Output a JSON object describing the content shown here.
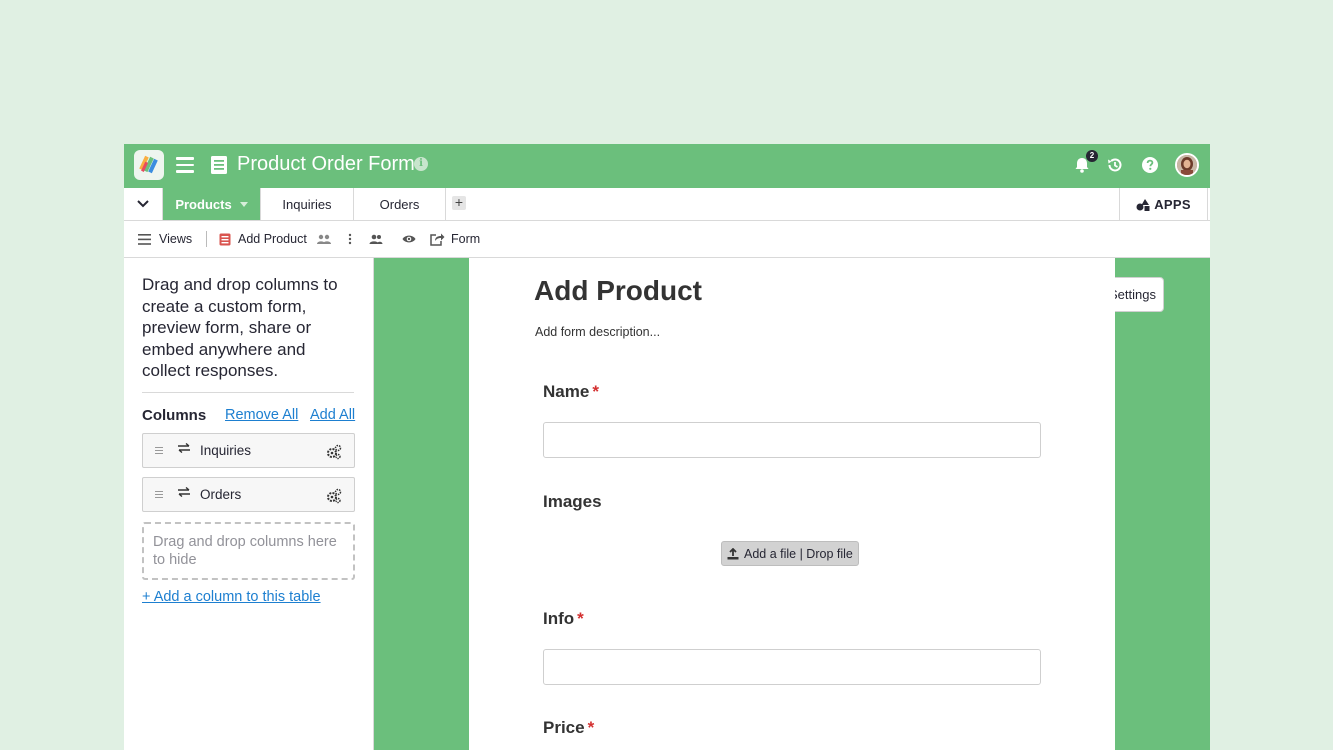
{
  "header": {
    "doc_title": "Product Order Form",
    "info_icon": "info-icon",
    "notification_count": "2"
  },
  "tabs": {
    "items": [
      {
        "label": "Products",
        "active": true
      },
      {
        "label": "Inquiries",
        "active": false
      },
      {
        "label": "Orders",
        "active": false
      }
    ],
    "add_label": "+",
    "apps_label": "APPS"
  },
  "toolbar": {
    "views_label": "Views",
    "section_label": "Add Product",
    "form_label": "Form"
  },
  "left_panel": {
    "intro": "Drag and drop columns to create a custom form, preview form, share or embed anywhere and collect responses.",
    "columns_heading": "Columns",
    "remove_all": "Remove All",
    "add_all": "Add All",
    "columns": [
      {
        "label": "Inquiries"
      },
      {
        "label": "Orders"
      }
    ],
    "drop_zone_text": "Drag and drop columns here to hide",
    "add_column_link": "+ Add a column to this table"
  },
  "form": {
    "settings_label": "Settings",
    "title": "Add Product",
    "description_placeholder": "Add form description...",
    "fields": [
      {
        "label": "Name",
        "required": true
      },
      {
        "label": "Images",
        "required": false
      },
      {
        "label": "Info",
        "required": true
      },
      {
        "label": "Price",
        "required": true
      }
    ],
    "required_mark": "*",
    "upload_label": "Add a file | Drop file"
  },
  "colors": {
    "brand_green": "#6bbf7c",
    "page_background": "#e0f0e3",
    "link_blue": "#1d7fd0",
    "required_red": "#d32f2f"
  }
}
